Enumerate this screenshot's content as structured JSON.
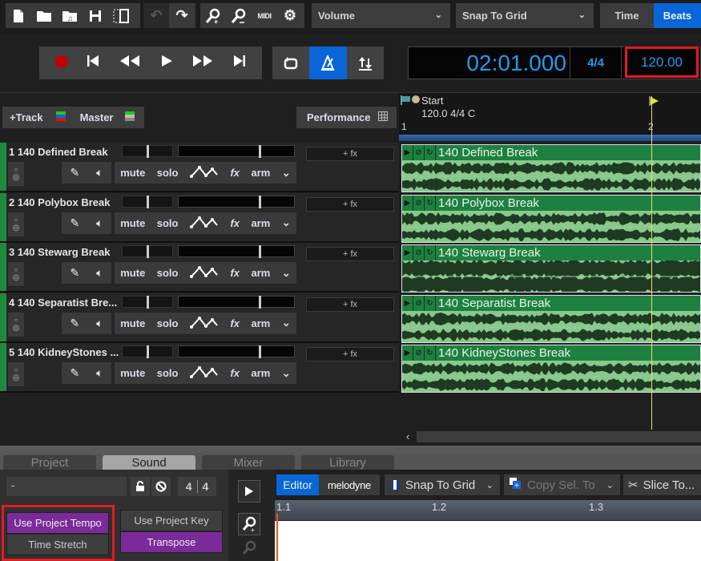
{
  "toolbar": {
    "icons": [
      "new-file-icon",
      "open-folder-icon",
      "open-audio-folder-icon",
      "save-icon",
      "split-view-icon",
      "undo-icon",
      "redo-icon",
      "zoom-in-icon",
      "zoom-out-icon",
      "midi-icon",
      "settings-icon"
    ],
    "midi_label": "MIDI",
    "automation_dropdown": "Volume",
    "snap_dropdown": "Snap To Grid",
    "time_label": "Time",
    "beats_label": "Beats",
    "beats_active": true
  },
  "transport": {
    "record_color": "#c00000",
    "time_display": "02:01.000",
    "time_signature": "4/4",
    "tempo": "120.00",
    "metronome_active": true
  },
  "track_header": {
    "add_track_label": "+Track",
    "master_label": "Master",
    "performance_label": "Performance"
  },
  "timeline": {
    "start_marker": "Start",
    "start_info": "120.0 4/4 C",
    "bar_1": "1",
    "bar_2": "2"
  },
  "tracks": [
    {
      "name": "1 140 Defined Break",
      "clip": "140 Defined Break"
    },
    {
      "name": "2 140 Polybox Break",
      "clip": "140 Polybox Break"
    },
    {
      "name": "3 140 Stewarg Break",
      "clip": "140 Stewarg Break"
    },
    {
      "name": "4 140 Separatist Bre...",
      "clip": "140 Separatist Break"
    },
    {
      "name": "5 140 KidneyStones ...",
      "clip": "140 KidneyStones Break"
    }
  ],
  "track_controls": {
    "fx_insert": "+ fx",
    "mute": "mute",
    "solo": "solo",
    "fx": "fx",
    "arm": "arm"
  },
  "bottom_tabs": [
    {
      "label": "Project",
      "active": false
    },
    {
      "label": "Sound",
      "active": true
    },
    {
      "label": "Mixer",
      "active": false
    },
    {
      "label": "Library",
      "active": false
    }
  ],
  "sound_panel": {
    "name_field": "-",
    "time_sig_num": "4",
    "time_sig_den": "4",
    "use_project_tempo": "Use Project Tempo",
    "time_stretch": "Time Stretch",
    "use_project_key": "Use Project Key",
    "transpose": "Transpose",
    "accent_color": "#7b2a9a"
  },
  "editor": {
    "editor_tab": "Editor",
    "melodyne_tab": "melodyne",
    "snap_dropdown": "Snap To Grid",
    "copy_dropdown": "Copy Sel. To",
    "slice_button": "Slice To...",
    "ruler": [
      "1.1",
      "1.2",
      "1.3"
    ]
  }
}
